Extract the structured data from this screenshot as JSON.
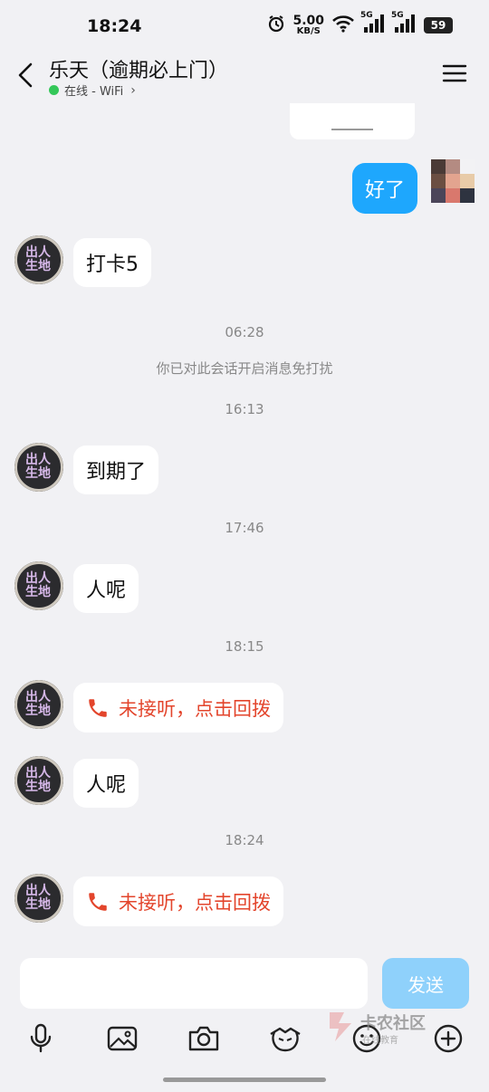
{
  "status_bar": {
    "time": "18:24",
    "speed_value": "5.00",
    "speed_unit": "KB/S",
    "net1": "5G",
    "net2": "5G",
    "battery": "59"
  },
  "header": {
    "title": "乐天（逾期必上门）",
    "status": "在线 - WiFi"
  },
  "messages": {
    "me_1": "好了",
    "m1": "打卡5",
    "time_1": "06:28",
    "system_1": "你已对此会话开启消息免打扰",
    "time_2": "16:13",
    "m2": "到期了",
    "time_3": "17:46",
    "m3": "人呢",
    "time_4": "18:15",
    "missed_1": "未接听，点击回拨",
    "m4": "人呢",
    "time_5": "18:24",
    "missed_2": "未接听，点击回拨"
  },
  "input": {
    "send_label": "发送",
    "value": ""
  },
  "watermark": {
    "text": "卡农社区",
    "sub": "在线教育"
  },
  "colors": {
    "accent": "#1ea7fd",
    "send_disabled": "#8fd1fb",
    "missed_call": "#e3452c",
    "online": "#34c759",
    "background": "#f1f1f4"
  }
}
